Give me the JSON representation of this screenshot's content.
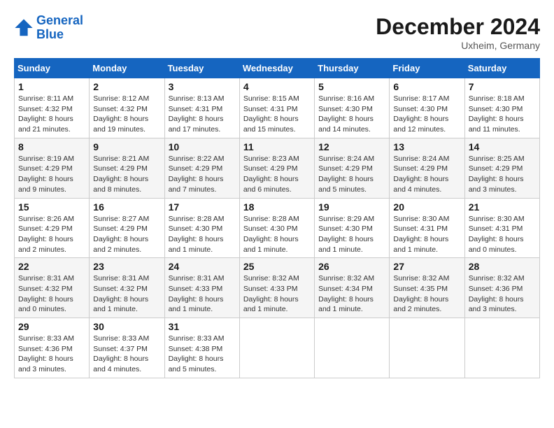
{
  "header": {
    "logo_line1": "General",
    "logo_line2": "Blue",
    "month_title": "December 2024",
    "location": "Uxheim, Germany"
  },
  "weekdays": [
    "Sunday",
    "Monday",
    "Tuesday",
    "Wednesday",
    "Thursday",
    "Friday",
    "Saturday"
  ],
  "weeks": [
    [
      {
        "day": "1",
        "sunrise": "8:11 AM",
        "sunset": "4:32 PM",
        "daylight": "8 hours and 21 minutes."
      },
      {
        "day": "2",
        "sunrise": "8:12 AM",
        "sunset": "4:32 PM",
        "daylight": "8 hours and 19 minutes."
      },
      {
        "day": "3",
        "sunrise": "8:13 AM",
        "sunset": "4:31 PM",
        "daylight": "8 hours and 17 minutes."
      },
      {
        "day": "4",
        "sunrise": "8:15 AM",
        "sunset": "4:31 PM",
        "daylight": "8 hours and 15 minutes."
      },
      {
        "day": "5",
        "sunrise": "8:16 AM",
        "sunset": "4:30 PM",
        "daylight": "8 hours and 14 minutes."
      },
      {
        "day": "6",
        "sunrise": "8:17 AM",
        "sunset": "4:30 PM",
        "daylight": "8 hours and 12 minutes."
      },
      {
        "day": "7",
        "sunrise": "8:18 AM",
        "sunset": "4:30 PM",
        "daylight": "8 hours and 11 minutes."
      }
    ],
    [
      {
        "day": "8",
        "sunrise": "8:19 AM",
        "sunset": "4:29 PM",
        "daylight": "8 hours and 9 minutes."
      },
      {
        "day": "9",
        "sunrise": "8:21 AM",
        "sunset": "4:29 PM",
        "daylight": "8 hours and 8 minutes."
      },
      {
        "day": "10",
        "sunrise": "8:22 AM",
        "sunset": "4:29 PM",
        "daylight": "8 hours and 7 minutes."
      },
      {
        "day": "11",
        "sunrise": "8:23 AM",
        "sunset": "4:29 PM",
        "daylight": "8 hours and 6 minutes."
      },
      {
        "day": "12",
        "sunrise": "8:24 AM",
        "sunset": "4:29 PM",
        "daylight": "8 hours and 5 minutes."
      },
      {
        "day": "13",
        "sunrise": "8:24 AM",
        "sunset": "4:29 PM",
        "daylight": "8 hours and 4 minutes."
      },
      {
        "day": "14",
        "sunrise": "8:25 AM",
        "sunset": "4:29 PM",
        "daylight": "8 hours and 3 minutes."
      }
    ],
    [
      {
        "day": "15",
        "sunrise": "8:26 AM",
        "sunset": "4:29 PM",
        "daylight": "8 hours and 2 minutes."
      },
      {
        "day": "16",
        "sunrise": "8:27 AM",
        "sunset": "4:29 PM",
        "daylight": "8 hours and 2 minutes."
      },
      {
        "day": "17",
        "sunrise": "8:28 AM",
        "sunset": "4:30 PM",
        "daylight": "8 hours and 1 minute."
      },
      {
        "day": "18",
        "sunrise": "8:28 AM",
        "sunset": "4:30 PM",
        "daylight": "8 hours and 1 minute."
      },
      {
        "day": "19",
        "sunrise": "8:29 AM",
        "sunset": "4:30 PM",
        "daylight": "8 hours and 1 minute."
      },
      {
        "day": "20",
        "sunrise": "8:30 AM",
        "sunset": "4:31 PM",
        "daylight": "8 hours and 1 minute."
      },
      {
        "day": "21",
        "sunrise": "8:30 AM",
        "sunset": "4:31 PM",
        "daylight": "8 hours and 0 minutes."
      }
    ],
    [
      {
        "day": "22",
        "sunrise": "8:31 AM",
        "sunset": "4:32 PM",
        "daylight": "8 hours and 0 minutes."
      },
      {
        "day": "23",
        "sunrise": "8:31 AM",
        "sunset": "4:32 PM",
        "daylight": "8 hours and 1 minute."
      },
      {
        "day": "24",
        "sunrise": "8:31 AM",
        "sunset": "4:33 PM",
        "daylight": "8 hours and 1 minute."
      },
      {
        "day": "25",
        "sunrise": "8:32 AM",
        "sunset": "4:33 PM",
        "daylight": "8 hours and 1 minute."
      },
      {
        "day": "26",
        "sunrise": "8:32 AM",
        "sunset": "4:34 PM",
        "daylight": "8 hours and 1 minute."
      },
      {
        "day": "27",
        "sunrise": "8:32 AM",
        "sunset": "4:35 PM",
        "daylight": "8 hours and 2 minutes."
      },
      {
        "day": "28",
        "sunrise": "8:32 AM",
        "sunset": "4:36 PM",
        "daylight": "8 hours and 3 minutes."
      }
    ],
    [
      {
        "day": "29",
        "sunrise": "8:33 AM",
        "sunset": "4:36 PM",
        "daylight": "8 hours and 3 minutes."
      },
      {
        "day": "30",
        "sunrise": "8:33 AM",
        "sunset": "4:37 PM",
        "daylight": "8 hours and 4 minutes."
      },
      {
        "day": "31",
        "sunrise": "8:33 AM",
        "sunset": "4:38 PM",
        "daylight": "8 hours and 5 minutes."
      },
      null,
      null,
      null,
      null
    ]
  ],
  "labels": {
    "sunrise_prefix": "Sunrise: ",
    "sunset_prefix": "Sunset: ",
    "daylight_prefix": "Daylight: "
  }
}
